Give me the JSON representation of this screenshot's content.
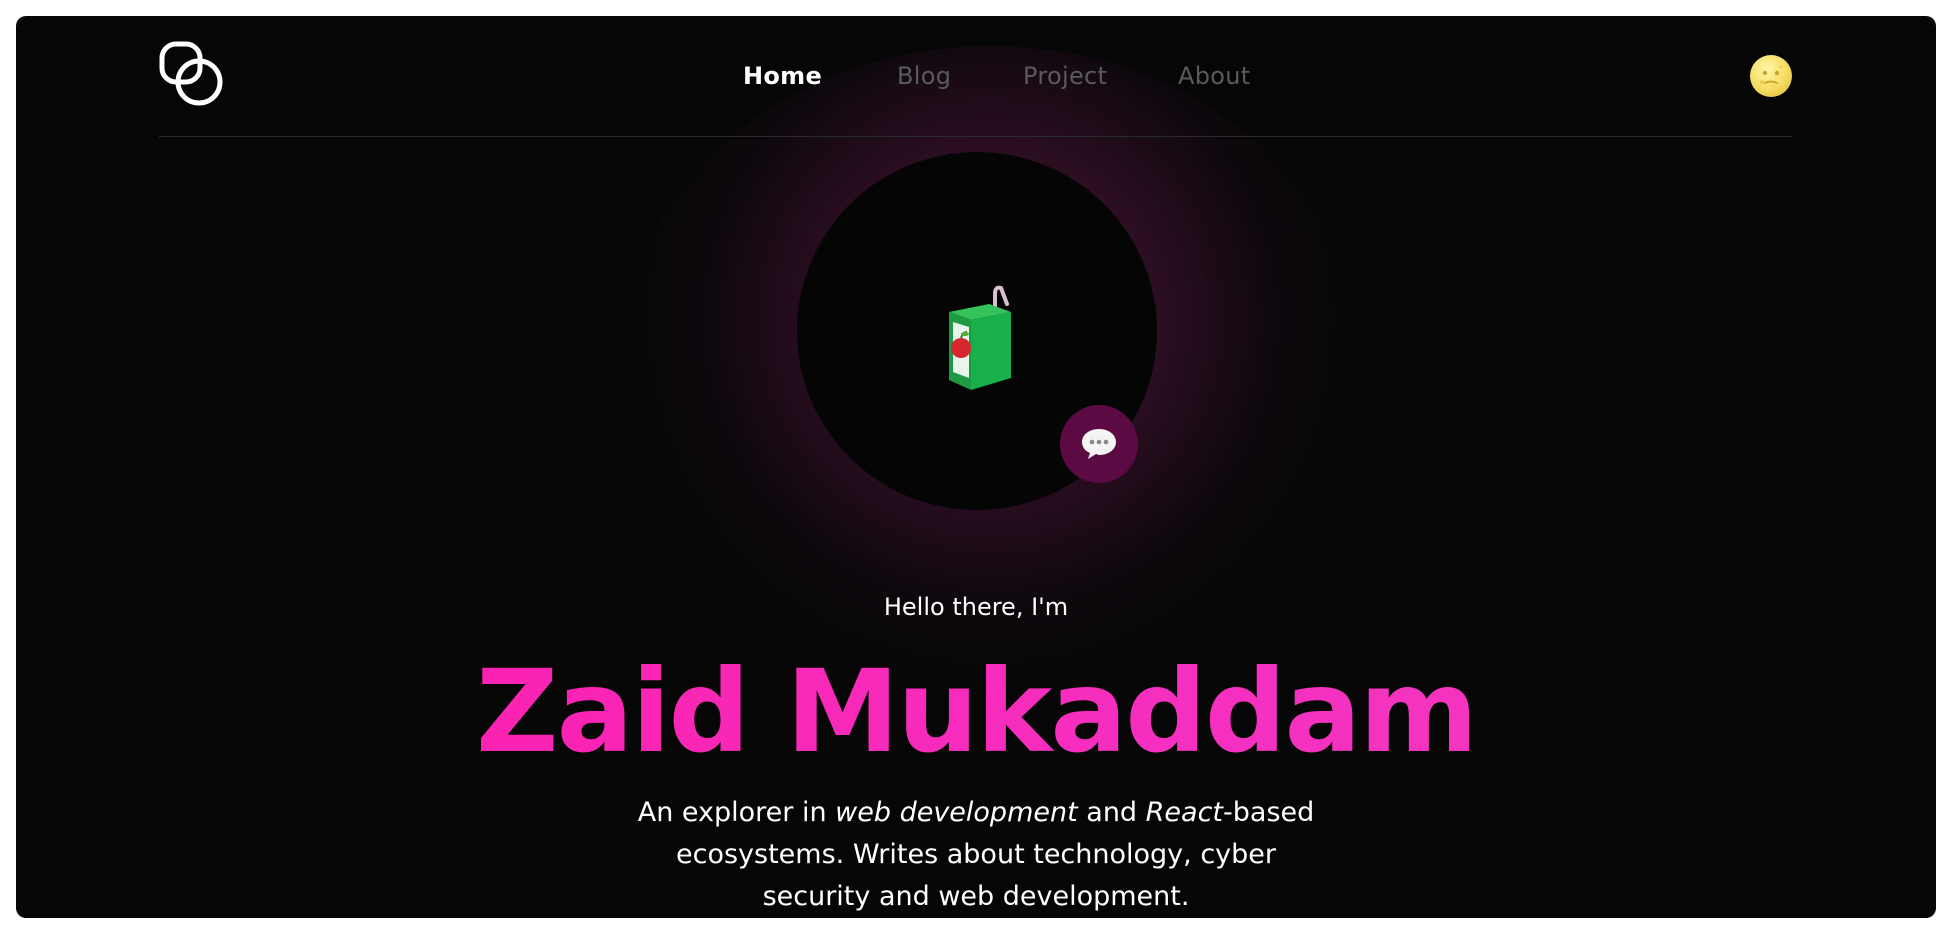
{
  "nav": {
    "links": [
      {
        "label": "Home",
        "active": true
      },
      {
        "label": "Blog",
        "active": false
      },
      {
        "label": "Project",
        "active": false
      },
      {
        "label": "About",
        "active": false
      }
    ]
  },
  "icons": {
    "logo": "two-overlapping-rings-logo",
    "theme_toggle": "moon-face-icon",
    "avatar": "juice-box-icon",
    "chat": "speech-bubble-icon"
  },
  "hero": {
    "greeting": "Hello there, I'm",
    "name": "Zaid Mukaddam",
    "bio": {
      "part1": "An explorer in ",
      "em1": "web development",
      "part2": " and ",
      "em2": "React",
      "part3": "-based ecosystems. Writes about technology, cyber security and web development."
    }
  },
  "colors": {
    "background": "#060606",
    "accent_name": "#ff1aa8",
    "chat_button": "#5c0a44",
    "nav_inactive": "#5a5a5a"
  }
}
